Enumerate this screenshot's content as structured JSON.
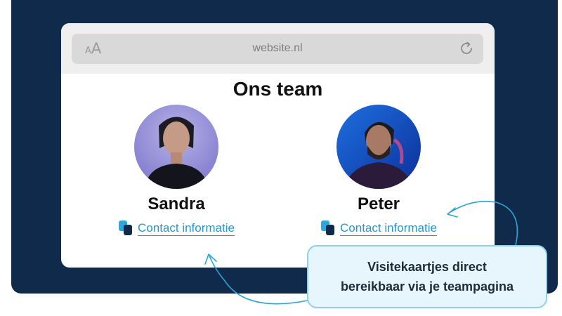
{
  "browser": {
    "text_size_small": "A",
    "text_size_large": "A",
    "url": "website.nl"
  },
  "page": {
    "title": "Ons team"
  },
  "team": [
    {
      "name": "Sandra",
      "link_label": "Contact informatie"
    },
    {
      "name": "Peter",
      "link_label": "Contact informatie"
    }
  ],
  "callout": {
    "line1": "Visitekaartjes direct",
    "line2": "bereikbaar via je teampagina"
  },
  "colors": {
    "backdrop": "#0f2a4a",
    "accent": "#1c9bd6",
    "callout_bg": "#e6f6fc",
    "callout_border": "#8fd0ea"
  },
  "icons": [
    "reload-icon",
    "business-card-icon"
  ]
}
